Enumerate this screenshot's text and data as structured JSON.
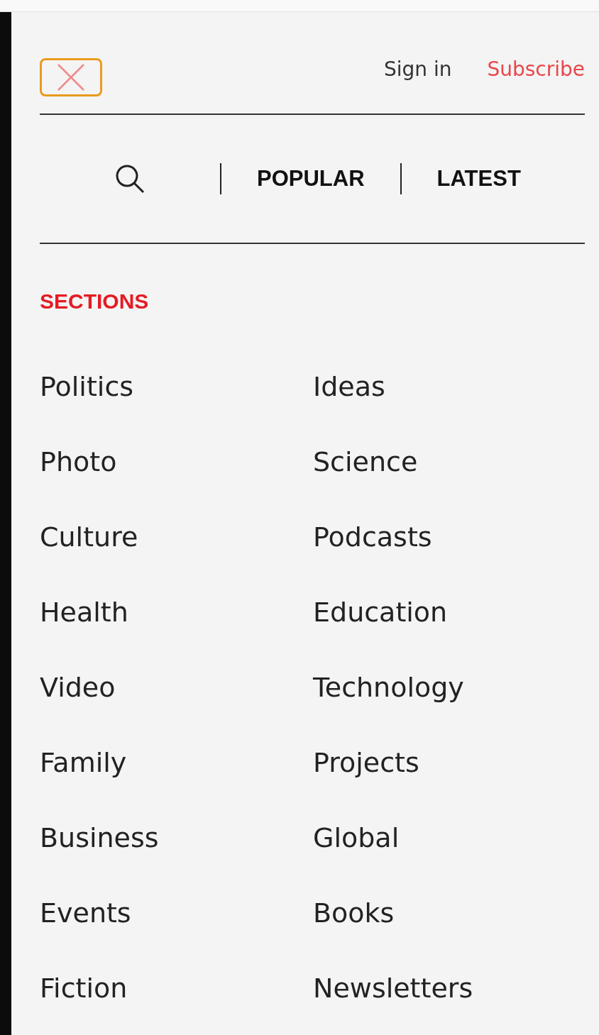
{
  "header": {
    "sign_in": "Sign in",
    "subscribe": "Subscribe"
  },
  "nav": {
    "links": [
      {
        "label": "POPULAR"
      },
      {
        "label": "LATEST"
      }
    ]
  },
  "sections": {
    "title": "SECTIONS",
    "columns": [
      [
        "Politics",
        "Photo",
        "Culture",
        "Health",
        "Video",
        "Family",
        "Business",
        "Events",
        "Fiction"
      ],
      [
        "Ideas",
        "Science",
        "Podcasts",
        "Education",
        "Technology",
        "Projects",
        "Global",
        "Books",
        "Newsletters"
      ]
    ]
  }
}
